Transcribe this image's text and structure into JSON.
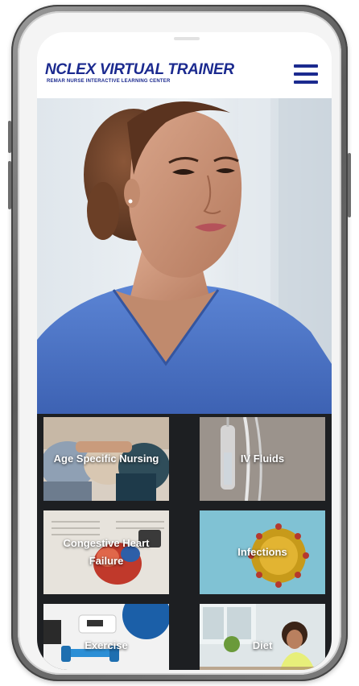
{
  "app": {
    "title": "NCLEX VIRTUAL TRAINER",
    "subtitle": "REMAR NURSE INTERACTIVE LEARNING CENTER"
  },
  "header": {
    "menu_icon": "hamburger-menu-icon"
  },
  "hero": {
    "image": "nurse-in-blue-scrubs-photo"
  },
  "tiles": [
    {
      "label": "Age Specific Nursing",
      "image": "people-seated-photo"
    },
    {
      "label": "IV Fluids",
      "image": "iv-drip-photo"
    },
    {
      "label": "Congestive Heart Failure",
      "image": "heart-model-on-book-photo"
    },
    {
      "label": "Infections",
      "image": "virus-microscope-photo"
    },
    {
      "label": "Exercise",
      "image": "dumbbells-and-scale-photo"
    },
    {
      "label": "Diet",
      "image": "woman-cooking-photo"
    }
  ],
  "colors": {
    "brand": "#1b2a8f",
    "scrubs": "#4a74c9",
    "grid_background": "#1d1f22"
  }
}
